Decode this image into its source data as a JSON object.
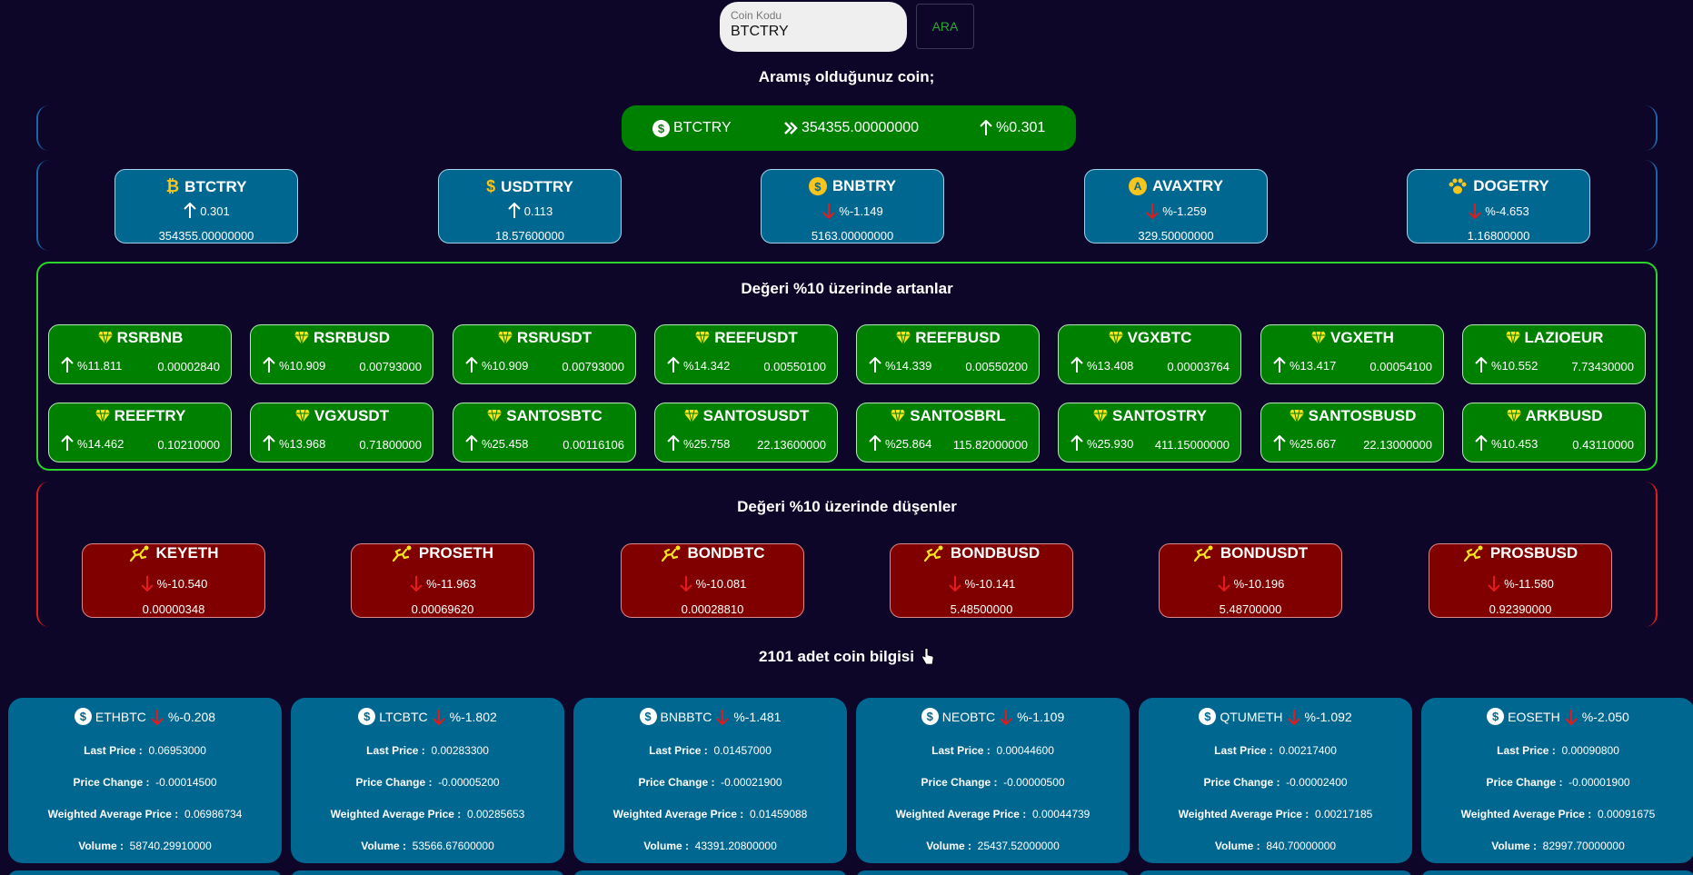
{
  "search": {
    "label": "Coin Kodu",
    "value": "BTCTRY",
    "button": "ARA"
  },
  "searched_heading": "Aramış olduğunuz coin;",
  "searched": {
    "symbol": "BTCTRY",
    "price": "354355.00000000",
    "change": "%0.301"
  },
  "top_coins": [
    {
      "symbol": "BTCTRY",
      "icon": "bitcoin-icon",
      "change": "0.301",
      "direction": "up",
      "price": "354355.00000000"
    },
    {
      "symbol": "USDTTRY",
      "icon": "dollar-icon",
      "change": "0.113",
      "direction": "up",
      "price": "18.57600000"
    },
    {
      "symbol": "BNBTRY",
      "icon": "coin-dollar-icon",
      "change": "%-1.149",
      "direction": "down",
      "price": "5163.00000000"
    },
    {
      "symbol": "AVAXTRY",
      "icon": "avax-icon",
      "change": "%-1.259",
      "direction": "down",
      "price": "329.50000000"
    },
    {
      "symbol": "DOGETRY",
      "icon": "paw-icon",
      "change": "%-4.653",
      "direction": "down",
      "price": "1.16800000"
    }
  ],
  "gainers_heading": "Değeri %10 üzerinde artanlar",
  "gainers": [
    {
      "symbol": "RSRBNB",
      "change": "%11.811",
      "price": "0.00002840"
    },
    {
      "symbol": "RSRBUSD",
      "change": "%10.909",
      "price": "0.00793000"
    },
    {
      "symbol": "RSRUSDT",
      "change": "%10.909",
      "price": "0.00793000"
    },
    {
      "symbol": "REEFUSDT",
      "change": "%14.342",
      "price": "0.00550100"
    },
    {
      "symbol": "REEFBUSD",
      "change": "%14.339",
      "price": "0.00550200"
    },
    {
      "symbol": "VGXBTC",
      "change": "%13.408",
      "price": "0.00003764"
    },
    {
      "symbol": "VGXETH",
      "change": "%13.417",
      "price": "0.00054100"
    },
    {
      "symbol": "LAZIOEUR",
      "change": "%10.552",
      "price": "7.73430000"
    },
    {
      "symbol": "REEFTRY",
      "change": "%14.462",
      "price": "0.10210000"
    },
    {
      "symbol": "VGXUSDT",
      "change": "%13.968",
      "price": "0.71800000"
    },
    {
      "symbol": "SANTOSBTC",
      "change": "%25.458",
      "price": "0.00116106"
    },
    {
      "symbol": "SANTOSUSDT",
      "change": "%25.758",
      "price": "22.13600000"
    },
    {
      "symbol": "SANTOSBRL",
      "change": "%25.864",
      "price": "115.82000000"
    },
    {
      "symbol": "SANTOSTRY",
      "change": "%25.930",
      "price": "411.15000000"
    },
    {
      "symbol": "SANTOSBUSD",
      "change": "%25.667",
      "price": "22.13000000"
    },
    {
      "symbol": "ARKBUSD",
      "change": "%10.453",
      "price": "0.43110000"
    }
  ],
  "losers_heading": "Değeri %10 üzerinde düşenler",
  "losers": [
    {
      "symbol": "KEYETH",
      "change": "%-10.540",
      "price": "0.00000348"
    },
    {
      "symbol": "PROSETH",
      "change": "%-11.963",
      "price": "0.00069620"
    },
    {
      "symbol": "BONDBTC",
      "change": "%-10.081",
      "price": "0.00028810"
    },
    {
      "symbol": "BONDBUSD",
      "change": "%-10.141",
      "price": "5.48500000"
    },
    {
      "symbol": "BONDUSDT",
      "change": "%-10.196",
      "price": "5.48700000"
    },
    {
      "symbol": "PROSBUSD",
      "change": "%-11.580",
      "price": "0.92390000"
    }
  ],
  "list_heading": "2101 adet coin bilgisi",
  "list_labels": {
    "last_price": "Last Price :",
    "price_change": "Price Change :",
    "weighted_avg": "Weighted Average Price :",
    "volume": "Volume :"
  },
  "coin_list": [
    {
      "symbol": "ETHBTC",
      "change": "%-0.208",
      "last_price": "0.06953000",
      "price_change": "-0.00014500",
      "weighted_avg": "0.06986734",
      "volume": "58740.29910000"
    },
    {
      "symbol": "LTCBTC",
      "change": "%-1.802",
      "last_price": "0.00283300",
      "price_change": "-0.00005200",
      "weighted_avg": "0.00285653",
      "volume": "53566.67600000"
    },
    {
      "symbol": "BNBBTC",
      "change": "%-1.481",
      "last_price": "0.01457000",
      "price_change": "-0.00021900",
      "weighted_avg": "0.01459088",
      "volume": "43391.20800000"
    },
    {
      "symbol": "NEOBTC",
      "change": "%-1.109",
      "last_price": "0.00044600",
      "price_change": "-0.00000500",
      "weighted_avg": "0.00044739",
      "volume": "25437.52000000"
    },
    {
      "symbol": "QTUMETH",
      "change": "%-1.092",
      "last_price": "0.00217400",
      "price_change": "-0.00002400",
      "weighted_avg": "0.00217185",
      "volume": "840.70000000"
    },
    {
      "symbol": "EOSETH",
      "change": "%-2.050",
      "last_price": "0.00090800",
      "price_change": "-0.00001900",
      "weighted_avg": "0.00091675",
      "volume": "82997.70000000"
    }
  ],
  "colors": {
    "background": "#0d0628",
    "card_blue": "#006791",
    "gain_green": "#008000",
    "loss_red": "#800000",
    "down_arrow": "#e01c1c"
  }
}
